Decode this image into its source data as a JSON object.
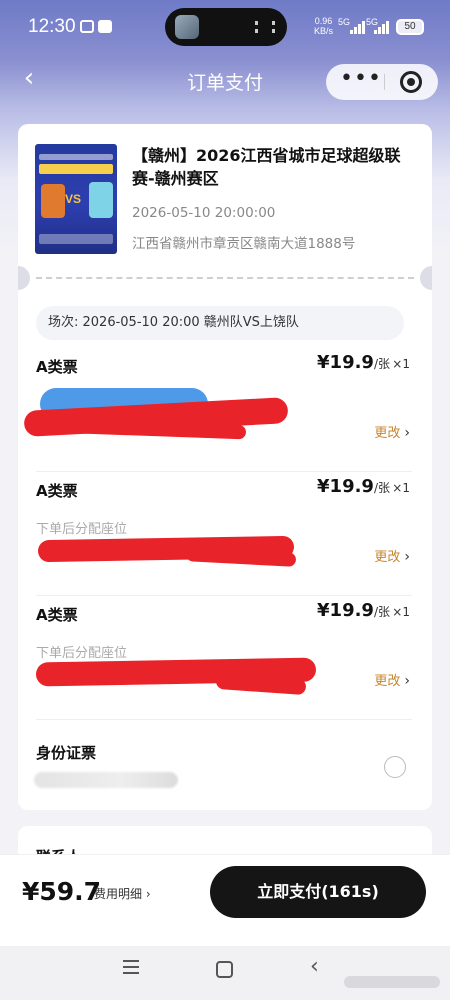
{
  "status_bar": {
    "time": "12:30",
    "network_speed": "0.96",
    "network_unit": "KB/s",
    "signal_1": "5G",
    "signal_2": "5G",
    "battery": "50"
  },
  "nav": {
    "title": "订单支付",
    "back_icon": "chevron-left-icon",
    "more_icon": "more-dots-icon",
    "more_glyph": "•••",
    "close_icon": "target-close-icon"
  },
  "event": {
    "title": "【赣州】2026江西省城市足球超级联赛-赣州赛区",
    "date": "2026-05-10 20:00:00",
    "address": "江西省赣州市章贡区赣南大道1888号",
    "session_label": "场次: 2026-05-10 20:00 赣州队VS上饶队"
  },
  "tickets": [
    {
      "name": "A类票",
      "price": "¥19.9",
      "unit": "/张",
      "qty": "×1",
      "seat_note": "",
      "change": "更改"
    },
    {
      "name": "A类票",
      "price": "¥19.9",
      "unit": "/张",
      "qty": "×1",
      "seat_note": "下单后分配座位",
      "change": "更改"
    },
    {
      "name": "A类票",
      "price": "¥19.9",
      "unit": "/张",
      "qty": "×1",
      "seat_note": "下单后分配座位",
      "change": "更改"
    }
  ],
  "id_section": {
    "label": "身份证票"
  },
  "contact": {
    "title": "联系人"
  },
  "pay": {
    "total": "¥59.7",
    "detail_label": "费用明细",
    "button_label": "立即支付(161s)"
  },
  "colors": {
    "accent": "#151515",
    "change_link": "#c8852f",
    "redaction_red": "#e8242a",
    "redaction_blue": "#3b8fe6"
  }
}
